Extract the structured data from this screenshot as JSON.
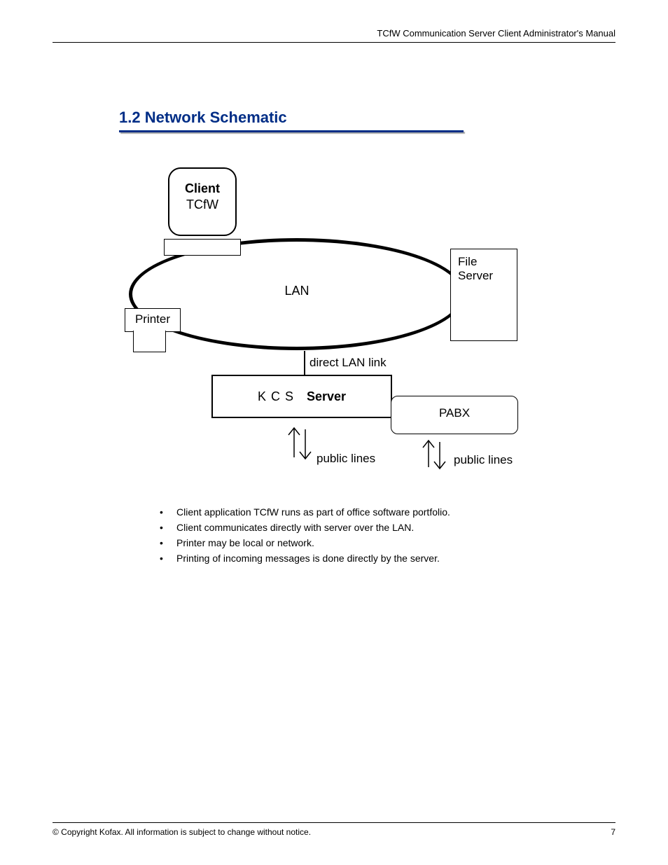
{
  "header": {
    "right": "TCfW Communication Server Client Administrator's Manual"
  },
  "section": {
    "title": "1.2 Network Schematic"
  },
  "diagram": {
    "client": {
      "line1": "Client",
      "line2": "TCfW"
    },
    "printer": "Printer",
    "lan": "LAN",
    "fileserver": {
      "line1": "File",
      "line2": "Server"
    },
    "direct_lan_link": "direct LAN link",
    "kcs": {
      "part1": "K C S",
      "part2": "Server"
    },
    "pabx": "PABX",
    "public_lines": "public lines"
  },
  "bullets": [
    "Client application TCfW runs as part of office software portfolio.",
    "Client communicates directly with server over the LAN.",
    "Printer may be local or network.",
    "Printing of incoming messages is done directly by the server."
  ],
  "footer": {
    "left": "© Copyright Kofax. All information is subject to change without notice.",
    "right": "7"
  }
}
